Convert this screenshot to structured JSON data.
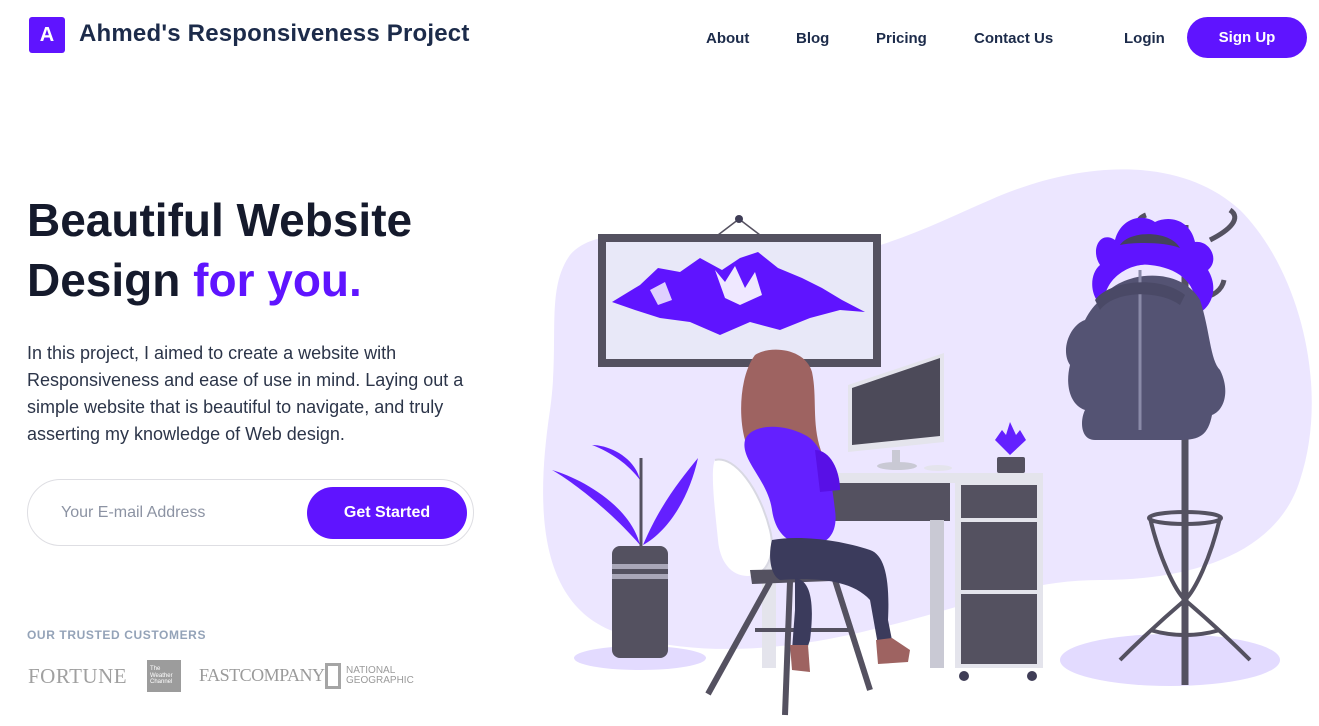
{
  "header": {
    "logo_letter": "A",
    "title": "Ahmed's Responsiveness Project",
    "nav": [
      {
        "label": "About"
      },
      {
        "label": "Blog"
      },
      {
        "label": "Pricing"
      },
      {
        "label": "Contact Us"
      }
    ],
    "login_label": "Login",
    "signup_label": "Sign Up"
  },
  "hero": {
    "title_line1": "Beautiful Website",
    "title_line2_plain": "Design ",
    "title_line2_accent": "for you.",
    "description": "In this project, I aimed to create a website with Responsiveness and ease of use in mind. Laying out a simple website that is beautiful to navigate, and truly asserting my knowledge of Web design.",
    "email_placeholder": "Your E-mail Address",
    "cta_label": "Get Started"
  },
  "customers": {
    "label": "OUR TRUSTED CUSTOMERS",
    "logos": [
      {
        "name": "fortune",
        "text": "FORTUNE"
      },
      {
        "name": "weather-channel",
        "text_lines": [
          "The",
          "Weather",
          "Channel"
        ]
      },
      {
        "name": "fast-company",
        "text": "FASTCOMPANY"
      },
      {
        "name": "national-geographic",
        "text_lines": [
          "NATIONAL",
          "GEOGRAPHIC"
        ]
      }
    ]
  },
  "colors": {
    "accent": "#5f14ff",
    "heading": "#151a2c",
    "nav_text": "#1c2b4a",
    "blob": "#ece6ff"
  }
}
